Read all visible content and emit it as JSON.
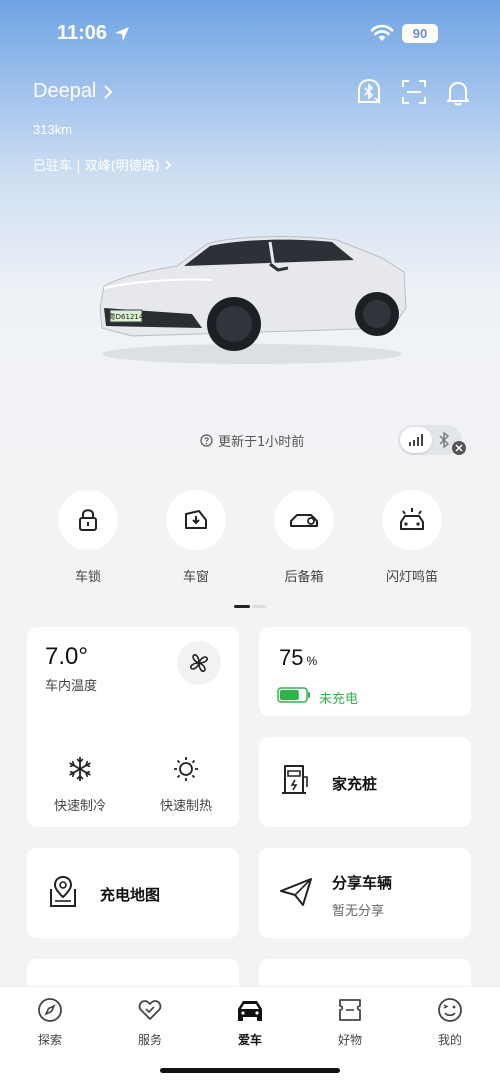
{
  "status_bar": {
    "time": "11:06",
    "battery": "90"
  },
  "header": {
    "car_name": "Deepal",
    "range": "313km",
    "location": "已驻车 | 双峰(明德路)"
  },
  "car": {
    "plate": "粤D61214"
  },
  "update": {
    "text": "更新于1小时前"
  },
  "quick_actions": [
    {
      "label": "车锁",
      "icon": "lock-icon"
    },
    {
      "label": "车窗",
      "icon": "window-icon"
    },
    {
      "label": "后备箱",
      "icon": "trunk-icon"
    },
    {
      "label": "闪灯鸣笛",
      "icon": "flash-horn-icon"
    }
  ],
  "climate": {
    "temperature": "7.0°",
    "temperature_label": "车内温度",
    "quick_cool": "快速制冷",
    "quick_heat": "快速制热"
  },
  "battery_card": {
    "percent": "75",
    "unit": "%",
    "status": "未充电",
    "level": 0.75,
    "color": "#33b24a"
  },
  "tiles": {
    "home_charger": "家充桩",
    "charging_map": "充电地图",
    "share_title": "分享车辆",
    "share_sub": "暂无分享"
  },
  "tabbar": [
    {
      "label": "探索",
      "icon": "explore-icon"
    },
    {
      "label": "服务",
      "icon": "service-icon"
    },
    {
      "label": "爱车",
      "icon": "car-icon",
      "active": true
    },
    {
      "label": "好物",
      "icon": "shop-icon"
    },
    {
      "label": "我的",
      "icon": "profile-icon"
    }
  ]
}
